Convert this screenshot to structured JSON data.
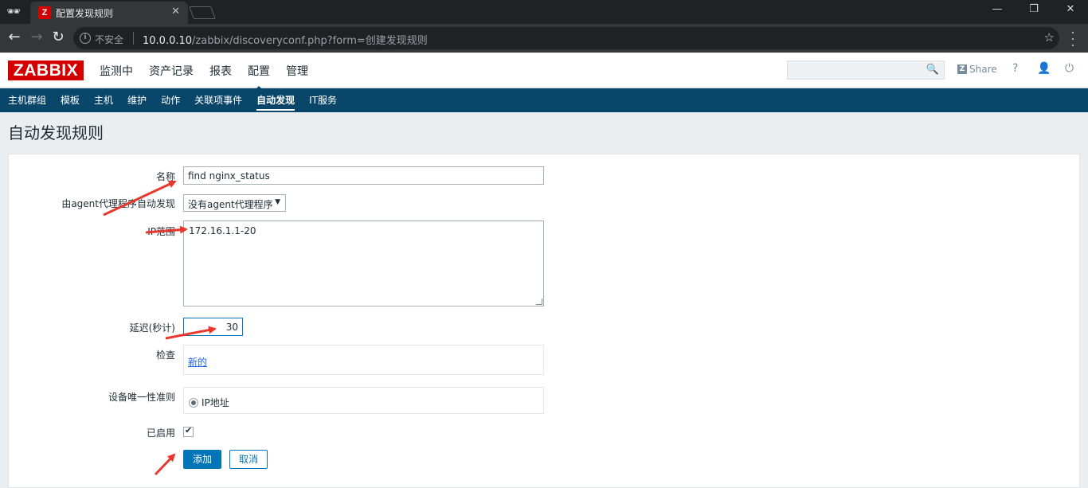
{
  "browser": {
    "tab_title": "配置发现规则",
    "tab_favicon": "Z",
    "security_label": "不安全",
    "url_host": "10.0.0.10",
    "url_path": "/zabbix/discoveryconf.php?form=创建发现规则"
  },
  "header": {
    "logo": "ZABBIX",
    "menu": [
      "监测中",
      "资产记录",
      "报表",
      "配置",
      "管理"
    ],
    "active_menu": "配置",
    "share_label": "Share",
    "help": "?"
  },
  "submenu": {
    "items": [
      "主机群组",
      "模板",
      "主机",
      "维护",
      "动作",
      "关联项事件",
      "自动发现",
      "IT服务"
    ],
    "active": "自动发现"
  },
  "page": {
    "title": "自动发现规则"
  },
  "form": {
    "name_label": "名称",
    "name_value": "find nginx_status",
    "proxy_label": "由agent代理程序自动发现",
    "proxy_value": "没有agent代理程序",
    "ip_label": "IP范围",
    "ip_value": "172.16.1.1-20",
    "delay_label": "延迟(秒计)",
    "delay_value": "30",
    "checks_label": "检查",
    "checks_link": "新的",
    "unique_label": "设备唯一性准则",
    "unique_value": "IP地址",
    "enabled_label": "已启用",
    "add_button": "添加",
    "cancel_button": "取消"
  },
  "colors": {
    "accent": "#0275b8",
    "brand": "#d40000",
    "nav": "#0a466a",
    "annotation": "#e8382e"
  }
}
